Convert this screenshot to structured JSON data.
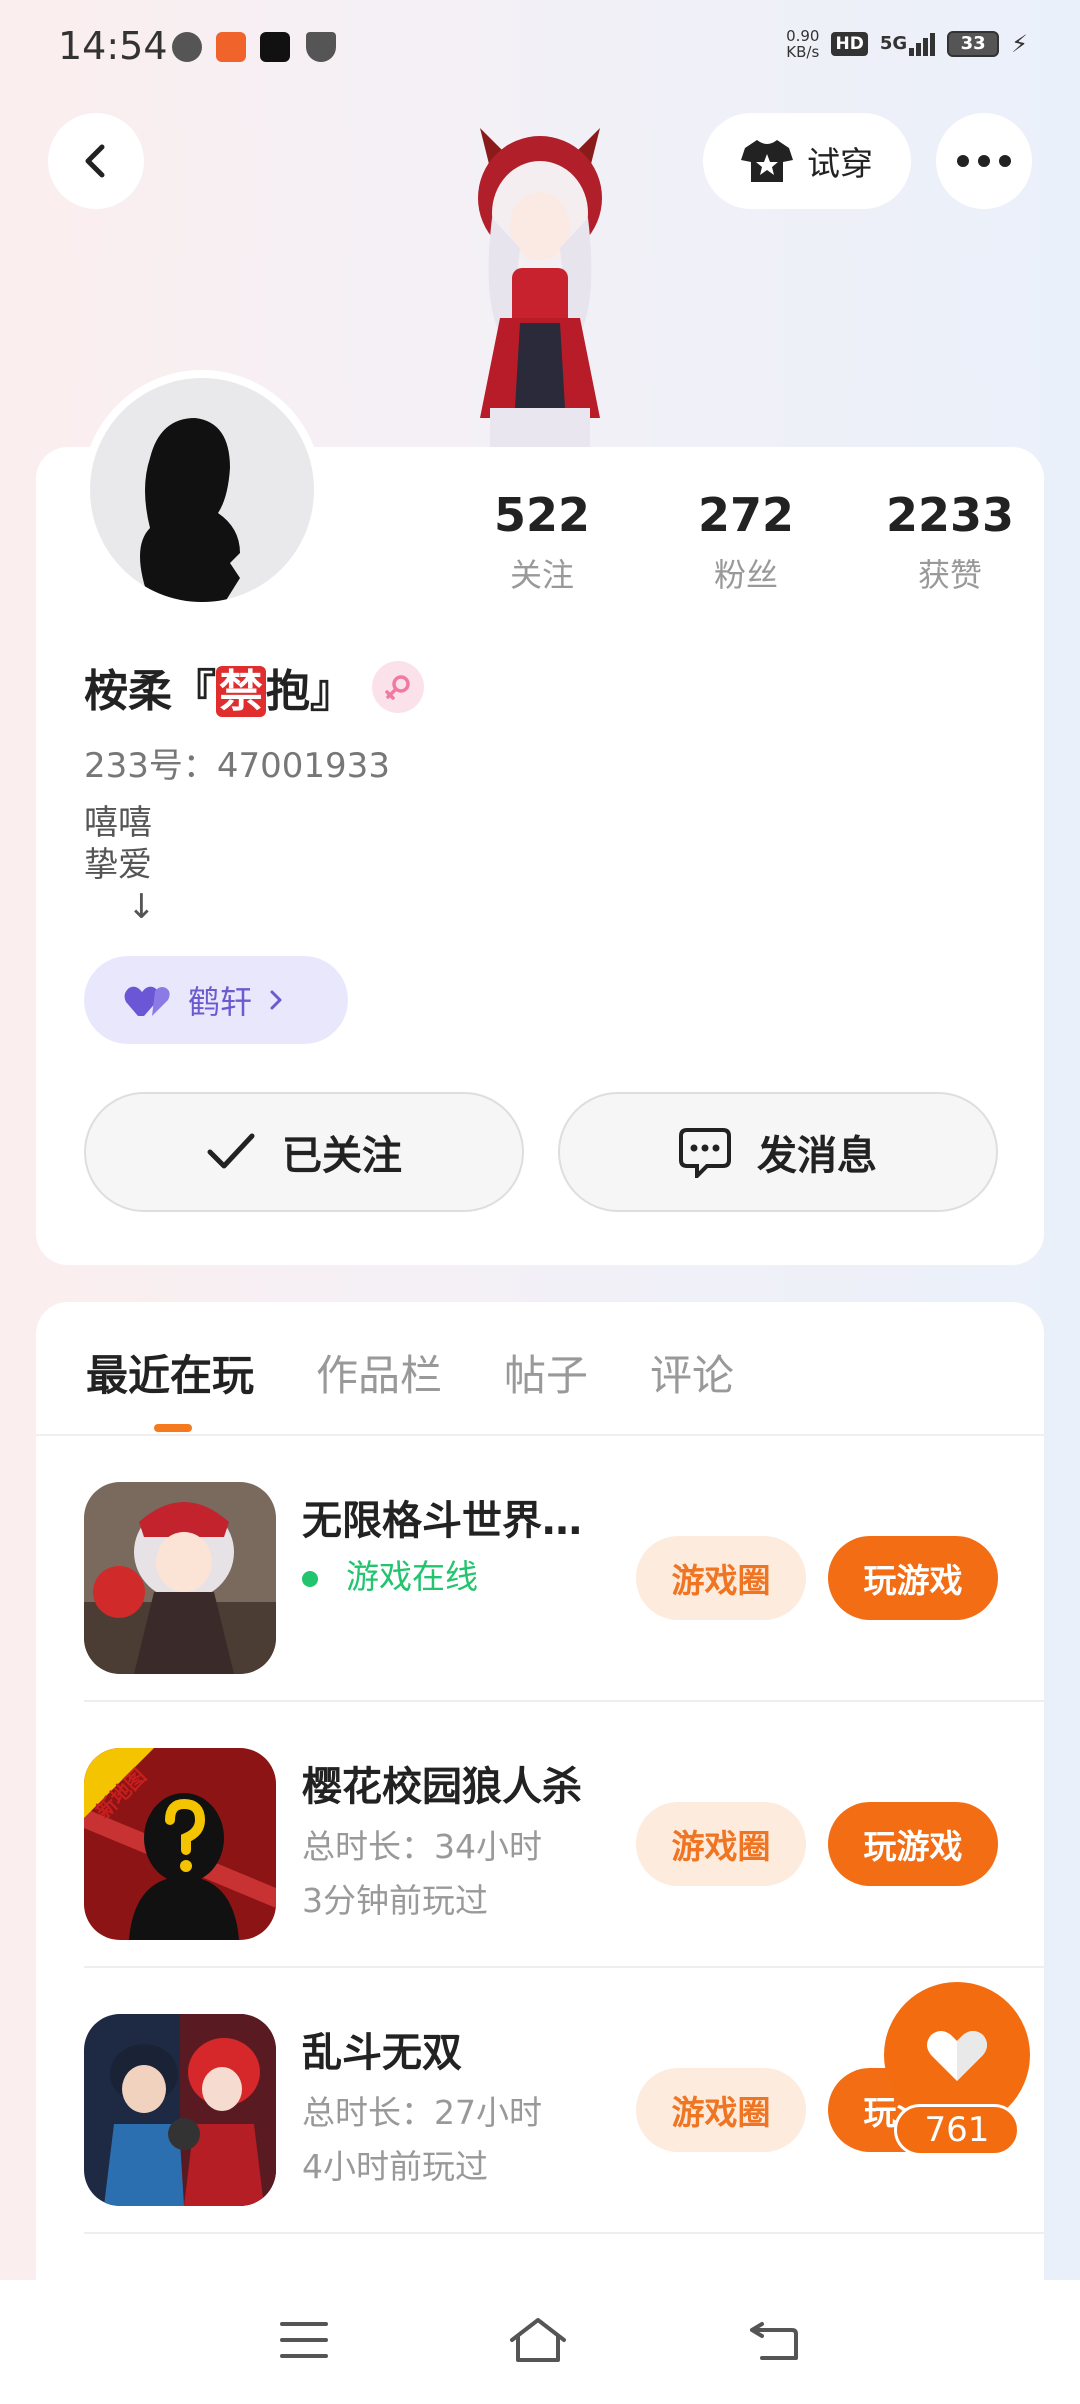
{
  "status_bar": {
    "time": "14:54",
    "net_speed_value": "0.90",
    "net_speed_unit": "KB/s",
    "hd": "HD",
    "network": "5G",
    "battery": "33"
  },
  "header": {
    "tryon_label": "试穿"
  },
  "profile": {
    "stats": [
      {
        "num": "522",
        "label": "关注"
      },
      {
        "num": "272",
        "label": "粉丝"
      },
      {
        "num": "2233",
        "label": "获赞"
      }
    ],
    "username_prefix": "桉柔『",
    "username_forbidden": "禁",
    "username_suffix": "抱』",
    "user_id": "233号：47001933",
    "bio": "嘻嘻\n挚爱\n    ↓",
    "couple_name": "鹤轩",
    "follow_label": "已关注",
    "message_label": "发消息"
  },
  "tabs": [
    "最近在玩",
    "作品栏",
    "帖子",
    "评论"
  ],
  "games": [
    {
      "name": "无限格斗世界…",
      "status": "游戏在线",
      "circle_label": "游戏圈",
      "play_label": "玩游戏"
    },
    {
      "name": "樱花校园狼人杀",
      "duration": "总时长：34小时",
      "last_played": "3分钟前玩过",
      "badge": "新地图",
      "circle_label": "游戏圈",
      "play_label": "玩游戏"
    },
    {
      "name": "乱斗无双",
      "duration": "总时长：27小时",
      "last_played": "4小时前玩过",
      "circle_label": "游戏圈",
      "play_label": "玩游戏"
    }
  ],
  "like": {
    "count": "761"
  }
}
